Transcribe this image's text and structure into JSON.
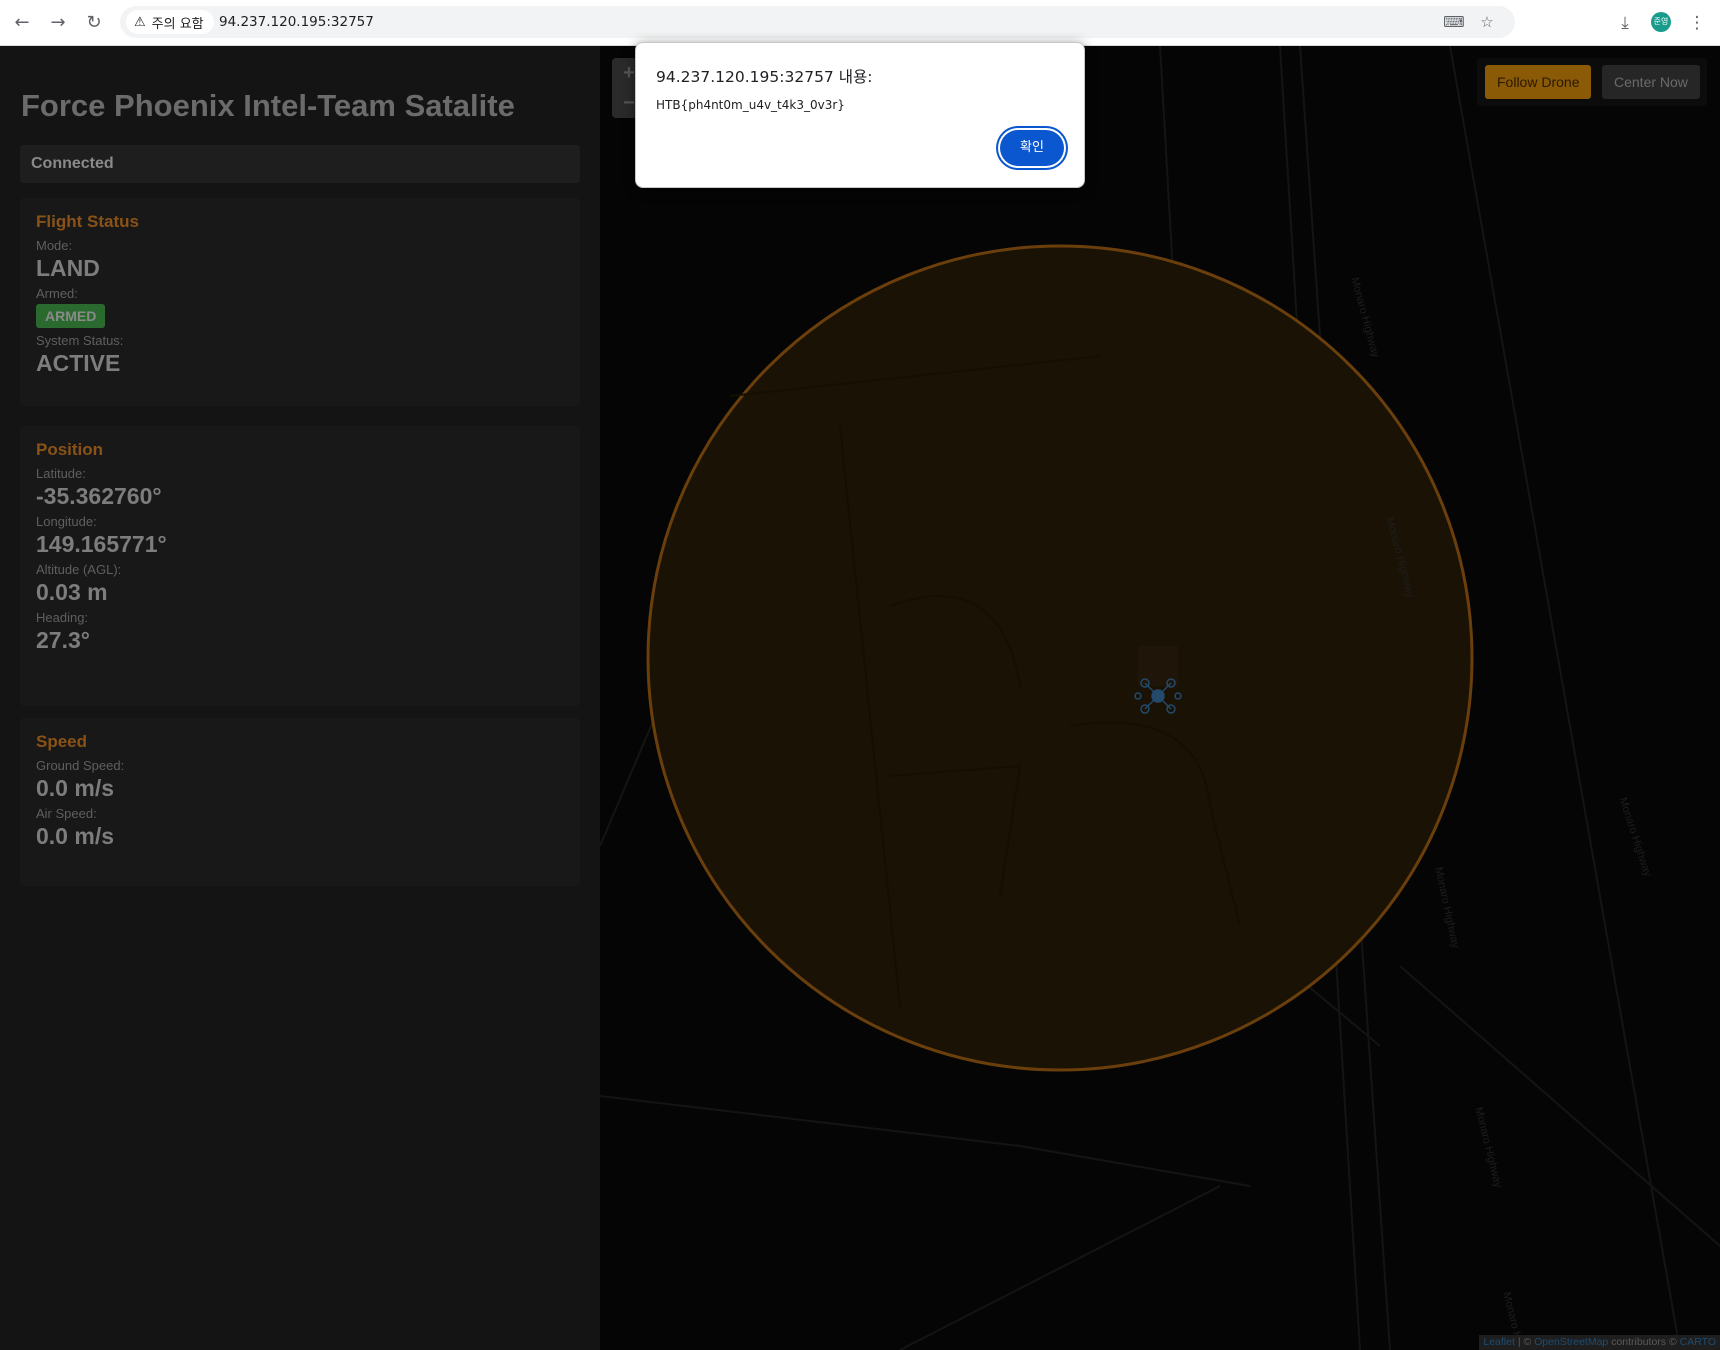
{
  "browser": {
    "security_label": "주의 요함",
    "url": "94.237.120.195:32757",
    "profile_initials": "준영"
  },
  "app": {
    "title": "Force Phoenix Intel-Team Satalite",
    "connection_status": "Connected"
  },
  "flight_status": {
    "title": "Flight Status",
    "mode_label": "Mode:",
    "mode_value": "LAND",
    "armed_label": "Armed:",
    "armed_value": "ARMED",
    "system_status_label": "System Status:",
    "system_status_value": "ACTIVE"
  },
  "position": {
    "title": "Position",
    "latitude_label": "Latitude:",
    "latitude_value": "-35.362760°",
    "longitude_label": "Longitude:",
    "longitude_value": "149.165771°",
    "altitude_label": "Altitude (AGL):",
    "altitude_value": "0.03 m",
    "heading_label": "Heading:",
    "heading_value": "27.3°"
  },
  "speed": {
    "title": "Speed",
    "ground_speed_label": "Ground Speed:",
    "ground_speed_value": "0.0 m/s",
    "air_speed_label": "Air Speed:",
    "air_speed_value": "0.0 m/s"
  },
  "map": {
    "zoom_in": "+",
    "zoom_out": "−",
    "follow_drone_label": "Follow Drone",
    "center_now_label": "Center Now",
    "road_label": "Monaro Highway",
    "attribution": {
      "leaflet": "Leaflet",
      "separator": " | © ",
      "osm": "OpenStreetMap",
      "contributors": " contributors © ",
      "carto": "CARTO"
    },
    "geofence_color": "#8a5216"
  },
  "dialog": {
    "title": "94.237.120.195:32757 내용:",
    "message": "HTB{ph4nt0m_u4v_t4k3_0v3r}",
    "ok_label": "확인"
  }
}
